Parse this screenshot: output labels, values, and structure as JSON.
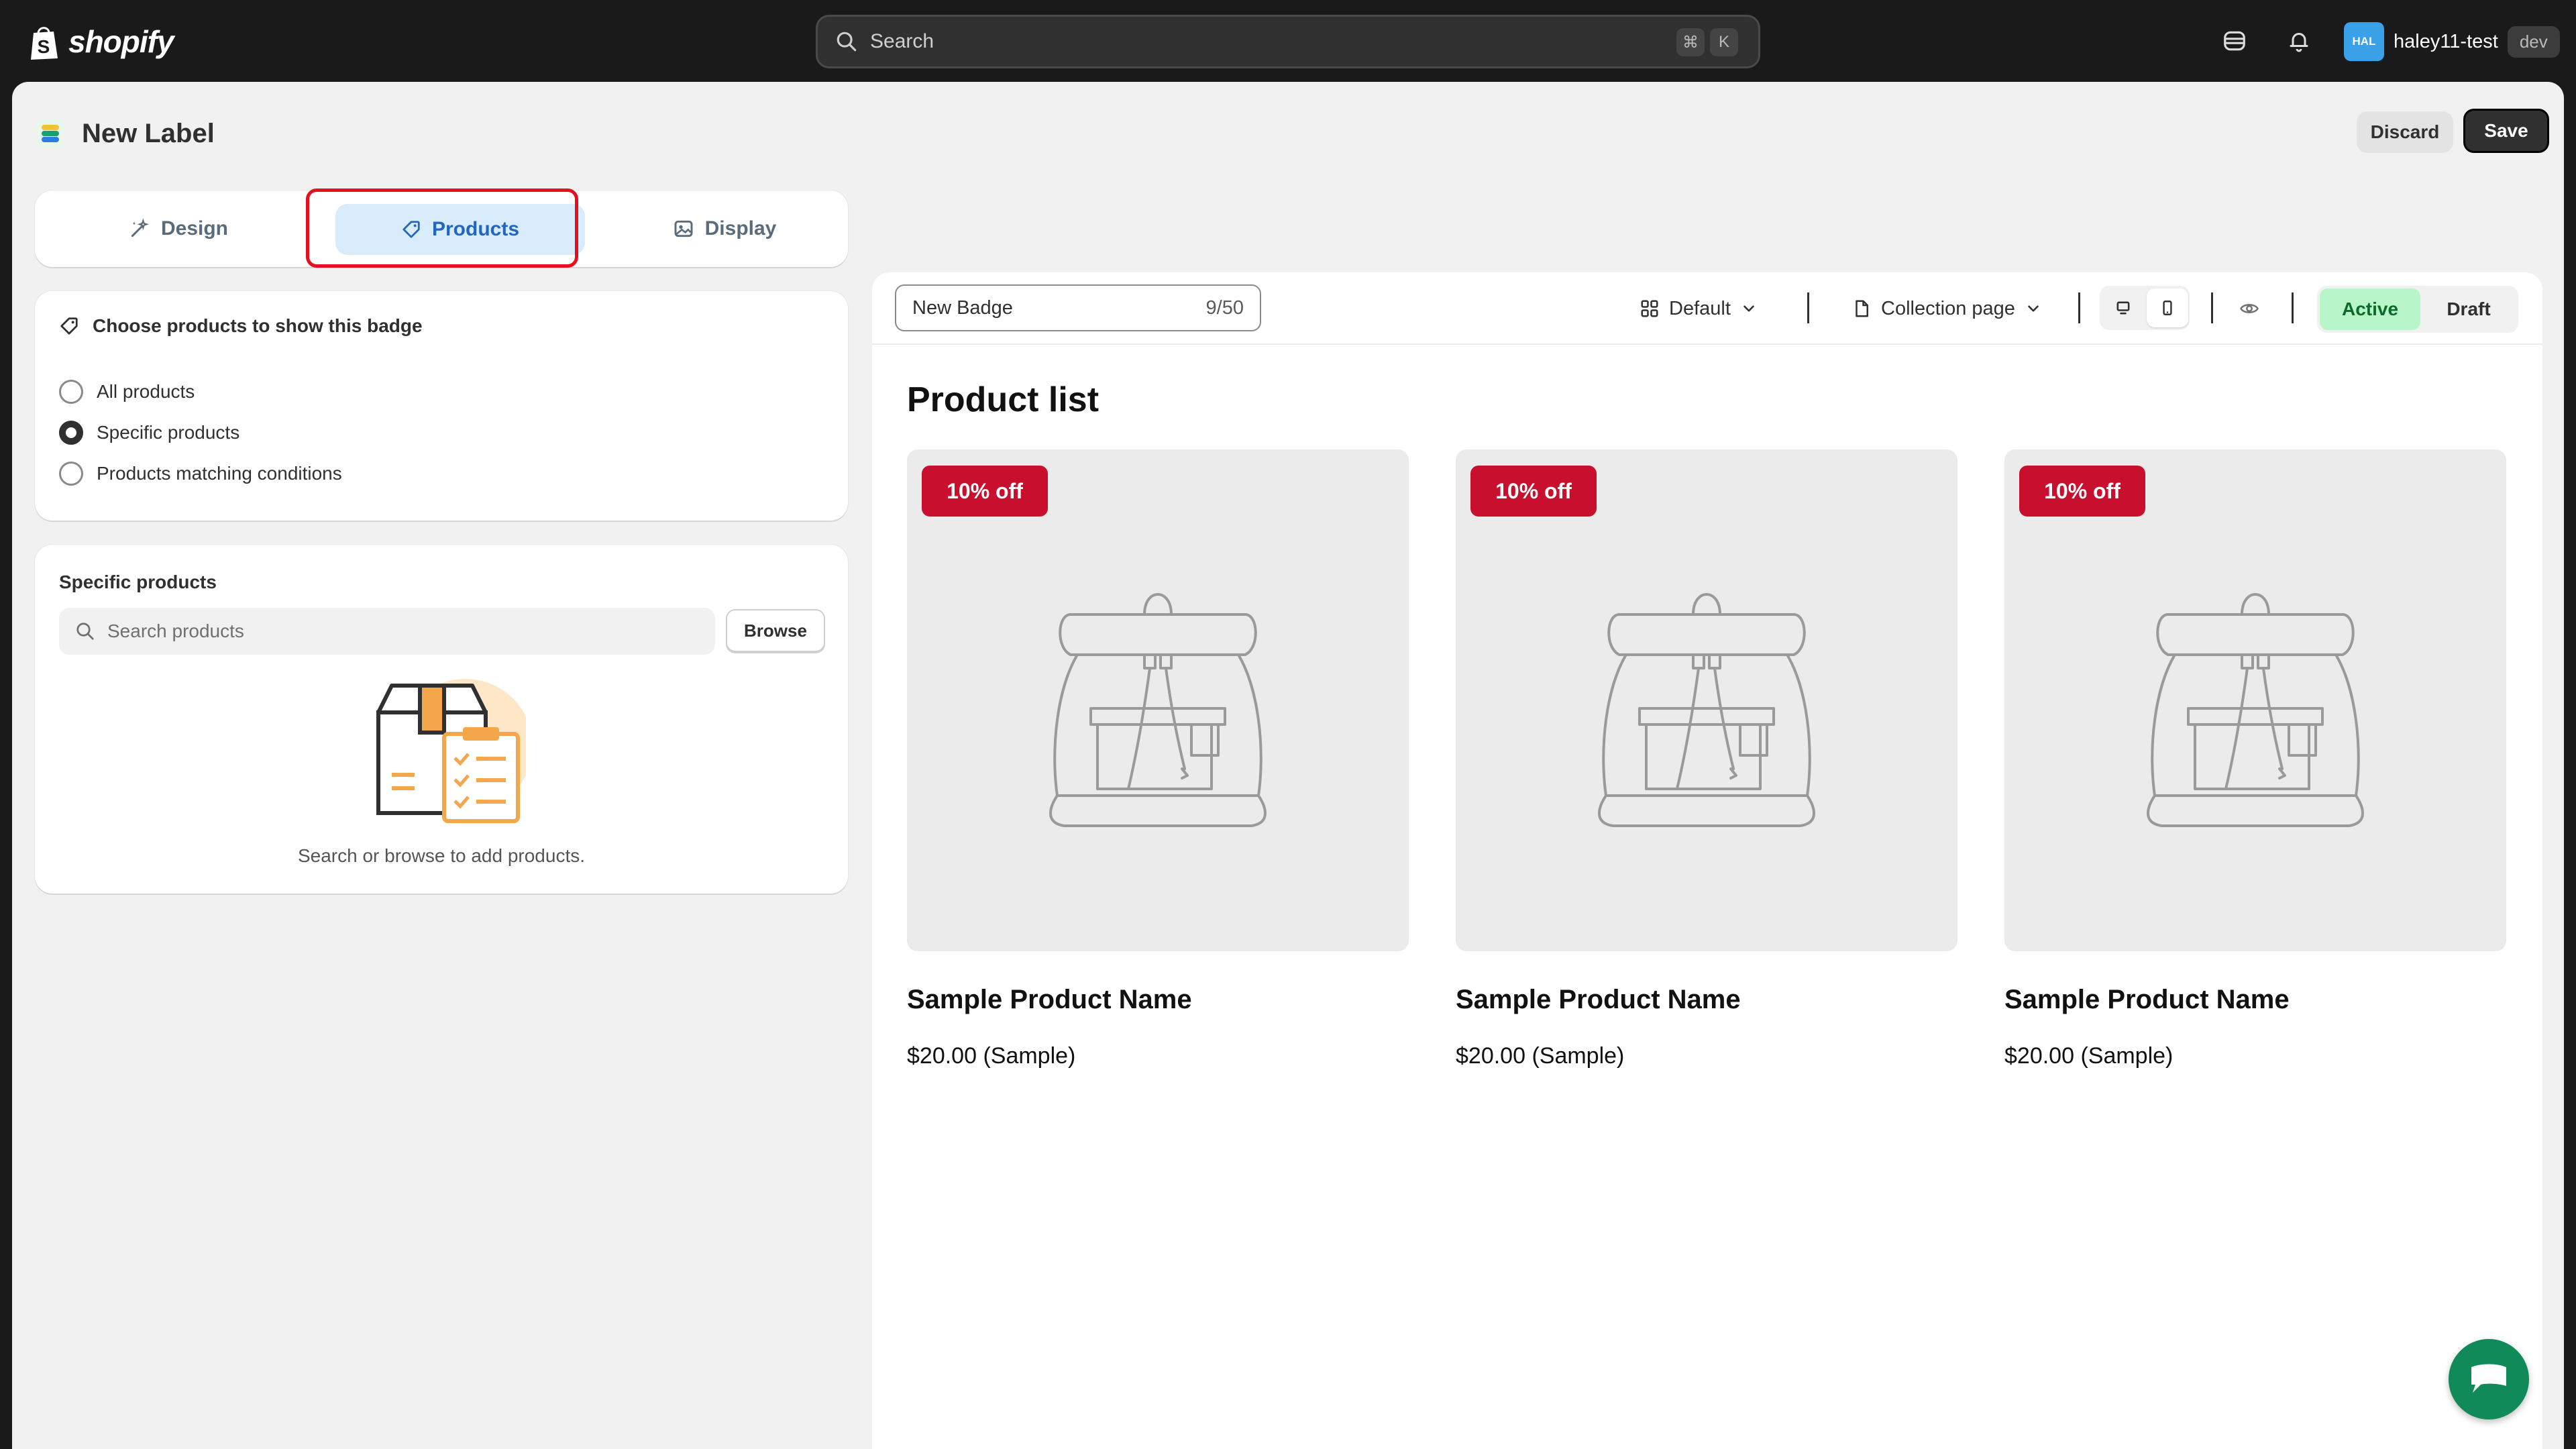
{
  "topbar": {
    "logo_text": "shopify",
    "search_placeholder": "Search",
    "shortcut_key1": "⌘",
    "shortcut_key2": "K",
    "avatar_initials": "HAL",
    "store_name": "haley11-test",
    "store_badge": "dev",
    "icons": [
      "shopify-bag-icon",
      "search-icon",
      "store-switch-icon",
      "bell-icon"
    ]
  },
  "page": {
    "title": "New Label",
    "discard_label": "Discard",
    "save_label": "Save"
  },
  "tabs": [
    {
      "label": "Design",
      "icon": "magic-wand-icon"
    },
    {
      "label": "Products",
      "icon": "tag-icon",
      "selected": true
    },
    {
      "label": "Display",
      "icon": "image-icon"
    }
  ],
  "choose": {
    "heading": "Choose products to show this badge",
    "options": [
      {
        "label": "All products",
        "selected": false
      },
      {
        "label": "Specific products",
        "selected": true
      },
      {
        "label": "Products matching conditions",
        "selected": false
      }
    ]
  },
  "specific": {
    "title": "Specific products",
    "search_placeholder": "Search products",
    "browse_label": "Browse",
    "empty_text": "Search or browse to add products."
  },
  "preview": {
    "badge_name": "New Badge",
    "char_counter": "9/50",
    "template_label": "Default",
    "page_label": "Collection page",
    "status_active": "Active",
    "status_draft": "Draft",
    "list_title": "Product list",
    "products": [
      {
        "badge": "10% off",
        "name": "Sample Product Name",
        "price": "$20.00 (Sample)"
      },
      {
        "badge": "10% off",
        "name": "Sample Product Name",
        "price": "$20.00 (Sample)"
      },
      {
        "badge": "10% off",
        "name": "Sample Product Name",
        "price": "$20.00 (Sample)"
      }
    ]
  },
  "colors": {
    "accent_blue": "#2266c2",
    "tab_selected_bg": "#d8ecfc",
    "highlight_red": "#e3101e",
    "badge_red": "#c8102e",
    "active_green_bg": "#b8f5c8",
    "chat_green": "#118a5a"
  }
}
